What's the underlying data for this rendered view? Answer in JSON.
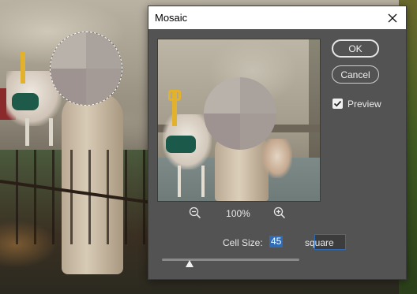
{
  "dialog": {
    "title": "Mosaic",
    "close_icon": "close-icon"
  },
  "buttons": {
    "ok_label": "OK",
    "cancel_label": "Cancel"
  },
  "preview_toggle": {
    "label": "Preview",
    "checked": true
  },
  "zoom": {
    "level": "100%",
    "zoom_out_icon": "zoom-out-icon",
    "zoom_in_icon": "zoom-in-icon"
  },
  "cell_size": {
    "label": "Cell Size:",
    "value": "45",
    "unit": "square",
    "slider_fraction": 0.2
  },
  "colors": {
    "dialog_bg": "#535353",
    "accent": "#2f6cb5",
    "mosaic_cells": [
      "#b9b2ab",
      "#aaa39d",
      "#9e9390",
      "#a49b96"
    ]
  }
}
